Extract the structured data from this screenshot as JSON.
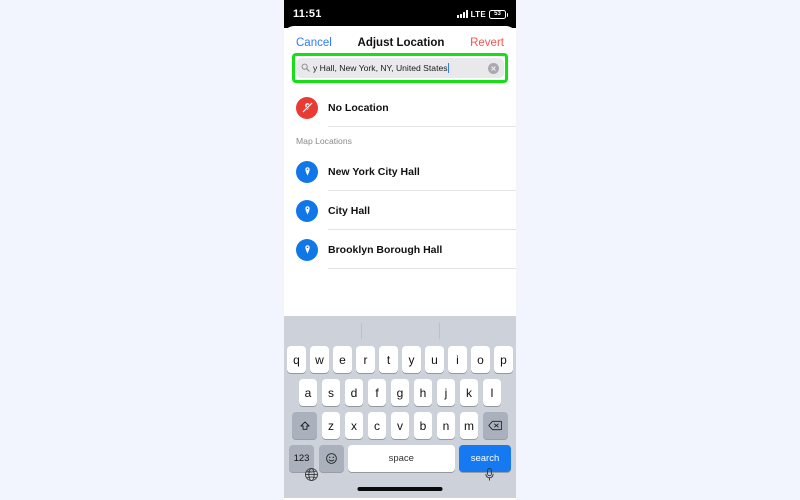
{
  "status_bar": {
    "time": "11:51",
    "network_label": "LTE",
    "battery_level": "53",
    "signal_icon": "signal-bars-icon",
    "battery_icon": "battery-icon"
  },
  "nav_bar": {
    "cancel_label": "Cancel",
    "title": "Adjust Location",
    "revert_label": "Revert",
    "cancel_color": "#2f7cf6",
    "revert_color": "#f4564f"
  },
  "search": {
    "icon": "search-icon",
    "value": "y Hall, New York, NY, United States",
    "clear_icon": "clear-circle-icon",
    "highlight_color": "#14e014",
    "highlighted": true
  },
  "list": {
    "no_location": {
      "label": "No Location",
      "icon": "no-location-pin-icon",
      "icon_color": "#ea3b32"
    },
    "section_header": "Map Locations",
    "items": [
      {
        "label": "New York City Hall",
        "icon": "map-pin-icon",
        "icon_color": "#1077e8"
      },
      {
        "label": "City Hall",
        "icon": "map-pin-icon",
        "icon_color": "#1077e8"
      },
      {
        "label": "Brooklyn Borough Hall",
        "icon": "map-pin-icon",
        "icon_color": "#1077e8"
      }
    ]
  },
  "keyboard": {
    "predictive_bar_empty": true,
    "row1": [
      "q",
      "w",
      "e",
      "r",
      "t",
      "y",
      "u",
      "i",
      "o",
      "p"
    ],
    "row2": [
      "a",
      "s",
      "d",
      "f",
      "g",
      "h",
      "j",
      "k",
      "l"
    ],
    "row3": [
      "z",
      "x",
      "c",
      "v",
      "b",
      "n",
      "m"
    ],
    "shift_icon": "shift-arrow-icon",
    "delete_icon": "backspace-icon",
    "numbers_label": "123",
    "emoji_icon": "emoji-smiley-icon",
    "space_label": "space",
    "search_label": "search",
    "search_key_color": "#1579f2",
    "globe_icon": "globe-icon",
    "dictation_icon": "microphone-icon"
  }
}
